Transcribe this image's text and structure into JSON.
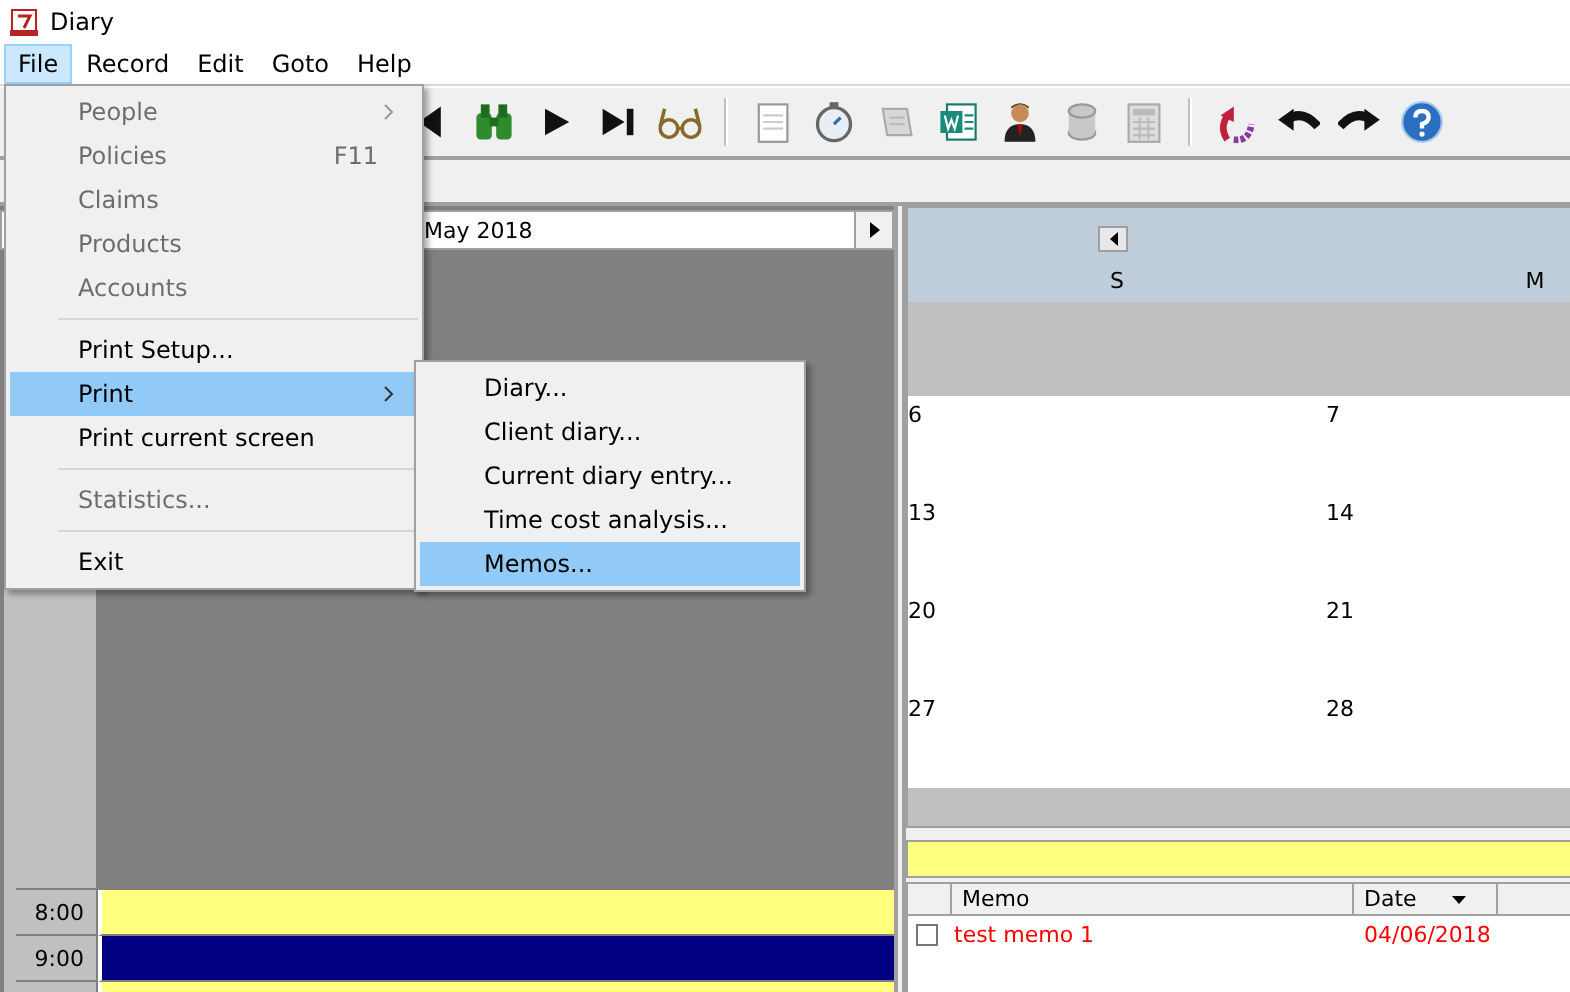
{
  "window": {
    "title": "Diary"
  },
  "menubar": [
    {
      "label": "File",
      "selected": true
    },
    {
      "label": "Record",
      "selected": false
    },
    {
      "label": "Edit",
      "selected": false
    },
    {
      "label": "Goto",
      "selected": false
    },
    {
      "label": "Help",
      "selected": false
    }
  ],
  "file_menu": [
    {
      "kind": "item",
      "label": "People",
      "disabled": true,
      "submenu": true,
      "selected": false
    },
    {
      "kind": "item",
      "label": "Policies",
      "shortcut": "F11",
      "disabled": true,
      "submenu": false,
      "selected": false
    },
    {
      "kind": "item",
      "label": "Claims",
      "disabled": true,
      "submenu": false,
      "selected": false
    },
    {
      "kind": "item",
      "label": "Products",
      "disabled": true,
      "submenu": false,
      "selected": false
    },
    {
      "kind": "item",
      "label": "Accounts",
      "disabled": true,
      "submenu": false,
      "selected": false
    },
    {
      "kind": "separator"
    },
    {
      "kind": "item",
      "label": "Print Setup...",
      "disabled": false,
      "submenu": false,
      "selected": false
    },
    {
      "kind": "item",
      "label": "Print",
      "disabled": false,
      "submenu": true,
      "selected": true
    },
    {
      "kind": "item",
      "label": "Print current screen",
      "disabled": false,
      "submenu": false,
      "selected": false
    },
    {
      "kind": "separator"
    },
    {
      "kind": "item",
      "label": "Statistics...",
      "disabled": true,
      "submenu": false,
      "selected": false
    },
    {
      "kind": "separator"
    },
    {
      "kind": "item",
      "label": "Exit",
      "disabled": false,
      "submenu": false,
      "selected": false
    }
  ],
  "print_submenu": [
    {
      "kind": "item",
      "label": "Diary...",
      "disabled": false,
      "submenu": false,
      "selected": false
    },
    {
      "kind": "item",
      "label": "Client diary...",
      "disabled": false,
      "submenu": false,
      "selected": false
    },
    {
      "kind": "item",
      "label": "Current diary entry...",
      "disabled": false,
      "submenu": false,
      "selected": false
    },
    {
      "kind": "item",
      "label": "Time cost analysis...",
      "disabled": false,
      "submenu": false,
      "selected": false
    },
    {
      "kind": "item",
      "label": "Memos...",
      "disabled": false,
      "submenu": false,
      "selected": true
    }
  ],
  "day_view": {
    "header": "May 2018",
    "slots": [
      {
        "time": "8:00",
        "selected": false
      },
      {
        "time": "9:00",
        "selected": true
      },
      {
        "selected": false
      }
    ]
  },
  "month_view": {
    "weekdays": [
      "S",
      "M"
    ],
    "weeks": [
      [
        "6",
        "7"
      ],
      [
        "13",
        "14"
      ],
      [
        "20",
        "21"
      ],
      [
        "27",
        "28"
      ]
    ]
  },
  "memos": {
    "columns": [
      "Memo",
      "Date"
    ],
    "rows": [
      {
        "checked": false,
        "memo": "test memo 1",
        "date": "04/06/2018"
      }
    ]
  }
}
